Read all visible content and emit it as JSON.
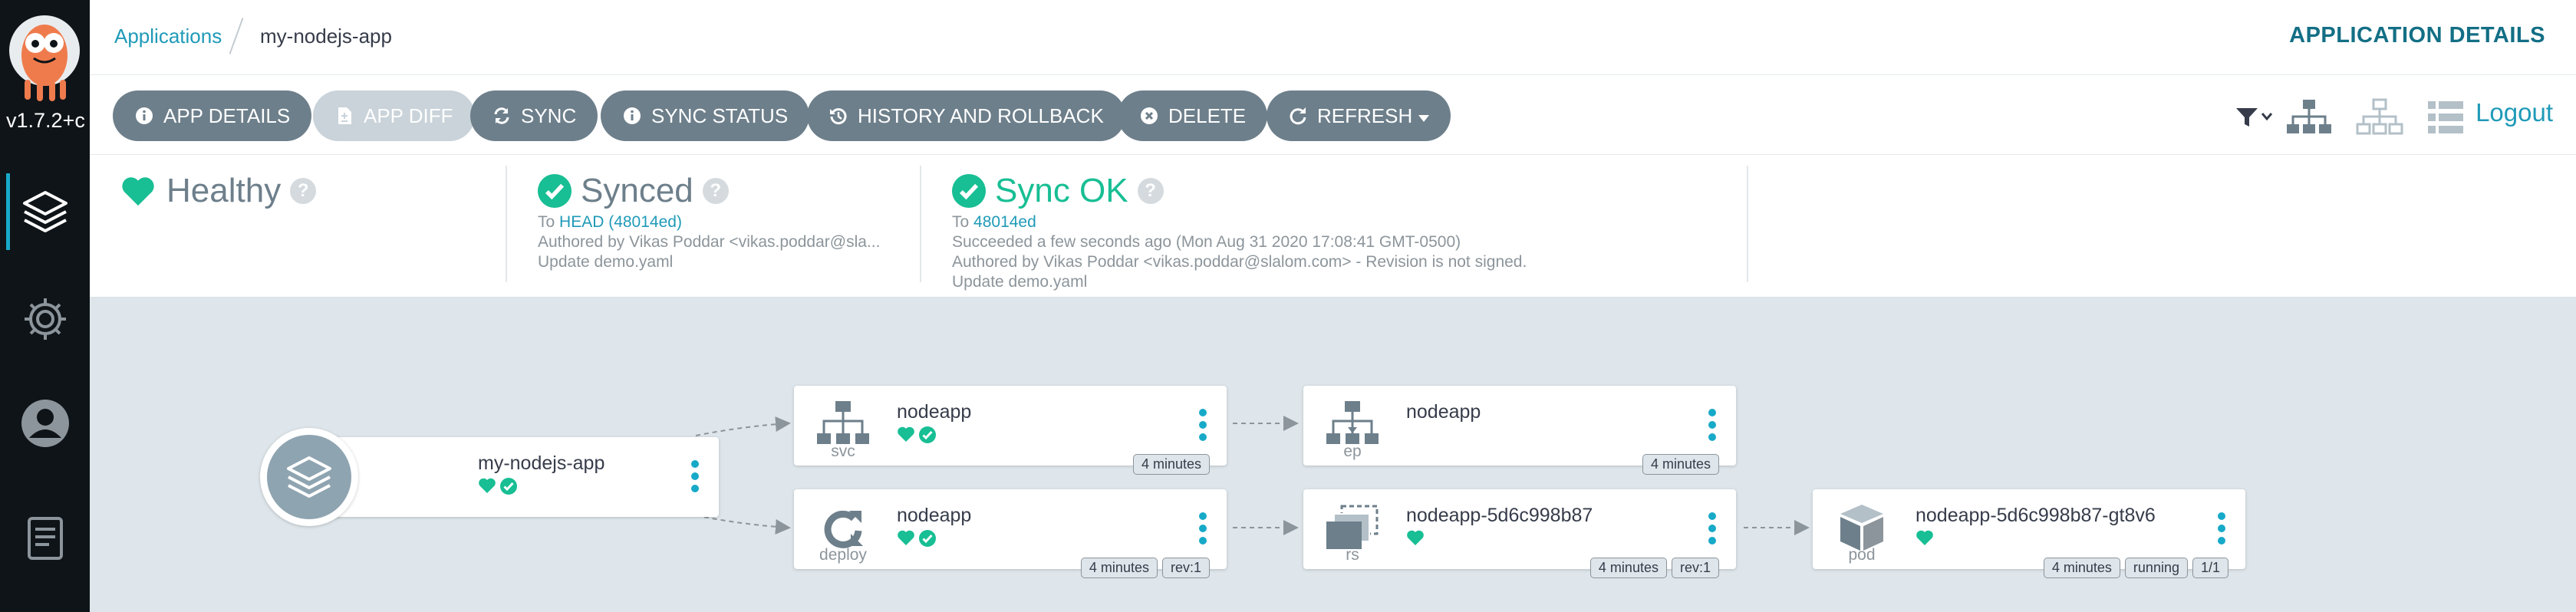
{
  "sidebar": {
    "version": "v1.7.2+c",
    "items": [
      {
        "name": "applications",
        "icon": "layers-icon"
      },
      {
        "name": "settings",
        "icon": "gear-icon"
      },
      {
        "name": "user",
        "icon": "user-icon"
      },
      {
        "name": "docs",
        "icon": "docs-icon"
      }
    ]
  },
  "breadcrumb": {
    "root": "Applications",
    "current": "my-nodejs-app"
  },
  "page_title": "APPLICATION DETAILS",
  "toolbar": {
    "app_details": "APP DETAILS",
    "app_diff": "APP DIFF",
    "sync": "SYNC",
    "sync_status": "SYNC STATUS",
    "history": "HISTORY AND ROLLBACK",
    "delete": "DELETE",
    "refresh": "REFRESH",
    "logout": "Logout"
  },
  "status": {
    "health": {
      "label": "Healthy"
    },
    "sync": {
      "label": "Synced",
      "to_prefix": "To",
      "revision": "HEAD (48014ed)",
      "author": "Authored by Vikas Poddar <vikas.poddar@sla...",
      "message": "Update demo.yaml"
    },
    "operation": {
      "label": "Sync OK",
      "to_prefix": "To",
      "revision": "48014ed",
      "time": "Succeeded a few seconds ago (Mon Aug 31 2020 17:08:41 GMT-0500)",
      "author": "Authored by Vikas Poddar <vikas.poddar@slalom.com> - Revision is not signed.",
      "message": "Update demo.yaml"
    }
  },
  "graph": {
    "root": {
      "title": "my-nodejs-app"
    },
    "svc": {
      "kind": "svc",
      "title": "nodeapp",
      "tags": [
        "4 minutes"
      ]
    },
    "ep": {
      "kind": "ep",
      "title": "nodeapp",
      "tags": [
        "4 minutes"
      ]
    },
    "deploy": {
      "kind": "deploy",
      "title": "nodeapp",
      "tags": [
        "4 minutes",
        "rev:1"
      ]
    },
    "rs": {
      "kind": "rs",
      "title": "nodeapp-5d6c998b87",
      "tags": [
        "4 minutes",
        "rev:1"
      ]
    },
    "pod": {
      "kind": "pod",
      "title": "nodeapp-5d6c998b87-gt8v6",
      "tags": [
        "4 minutes",
        "running",
        "1/1"
      ]
    }
  },
  "colors": {
    "healthy": "#18be94",
    "accent": "#1f9ab8",
    "button": "#6d7f8b"
  }
}
